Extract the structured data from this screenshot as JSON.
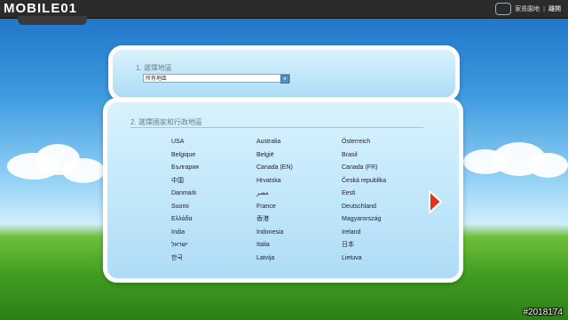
{
  "header": {
    "logo_text": "MOBILE01",
    "links": [
      "家長園地",
      "離開"
    ]
  },
  "step1": {
    "title": "1. 選擇地區",
    "select_value": "所有地區"
  },
  "step2": {
    "title": "2. 選擇國家和行政地區",
    "columns": [
      [
        "USA",
        "Belgique",
        "България",
        "中国",
        "Danmark",
        "Suomi",
        "Ελλάδα",
        "India",
        "ישראל",
        "한국"
      ],
      [
        "Australia",
        "België",
        "Canada (EN)",
        "Hrvatska",
        "مصر",
        "France",
        "香港",
        "Indonesia",
        "Italia",
        "Latvija"
      ],
      [
        "Österreich",
        "Brasil",
        "Canada (FR)",
        "Česká republika",
        "Eesti",
        "Deutschland",
        "Magyarország",
        "Ireland",
        "日本",
        "Lietuva"
      ]
    ]
  },
  "watermark": "#2018174"
}
